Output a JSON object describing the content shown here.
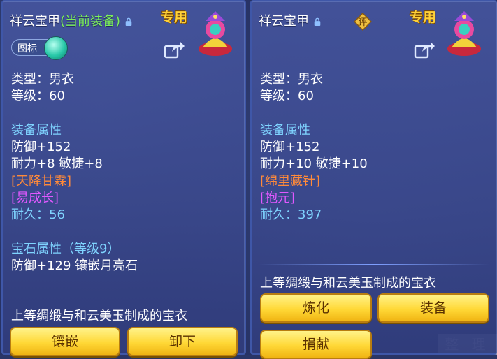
{
  "left_panel": {
    "title_name": "祥云宝甲",
    "title_status": "(当前装备)",
    "exclusive_label": "专用",
    "toggle_label": "图标",
    "type_line": "类型：男衣",
    "level_line": "等级：60",
    "attr_header": "装备属性",
    "defense_line": "防御+152",
    "stats_line": "耐力+8 敏捷+8",
    "special1": "[天降甘霖]",
    "special2": "[易成长]",
    "durability_label": "耐久：",
    "durability_value": "56",
    "gem_header": "宝石属性（等级9）",
    "gem_line": "防御+129 镶嵌月亮石",
    "description": "上等绸缎与和云美玉制成的宝衣",
    "buttons": [
      "镶嵌",
      "卸下"
    ]
  },
  "right_panel": {
    "title_name": "祥云宝甲",
    "exclusive_label": "专用",
    "rating_label": "评",
    "type_line": "类型：男衣",
    "level_line": "等级：60",
    "attr_header": "装备属性",
    "defense_line": "防御+152",
    "stats_line": "耐力+10 敏捷+10",
    "special1": "[绵里藏针]",
    "special2": "[抱元]",
    "durability_label": "耐久：",
    "durability_value": "397",
    "description": "上等绸缎与和云美玉制成的宝衣",
    "buttons": [
      "炼化",
      "装备",
      "捐献"
    ]
  },
  "background": {
    "organize_button": "整 理"
  },
  "colors": {
    "accent_green": "#7cf05a",
    "blue_text": "#7fd4ff",
    "orange_text": "#ff8a3a",
    "purple_text": "#e058ff",
    "button_gold": "#ffd836"
  },
  "icons": [
    "lock-icon",
    "share-icon",
    "rating-icon",
    "character-avatar"
  ]
}
